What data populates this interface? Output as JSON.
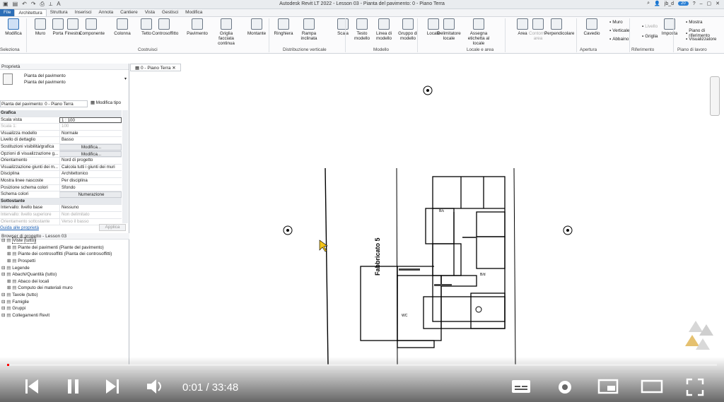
{
  "window": {
    "title": "Autodesk Revit LT 2022 - Lesson 03 - Pianta del pavimento: 0 - Piano Terra",
    "user": "jb_d",
    "badge": "20"
  },
  "tabs": [
    "File",
    "Architettura",
    "Struttura",
    "Inserisci",
    "Annota",
    "Cantiere",
    "Vista",
    "Gestisci",
    "Modifica"
  ],
  "ribbon": {
    "buttons": [
      "Modifica",
      "Muro",
      "Porta",
      "Finestra",
      "Componente",
      "Colonna",
      "Tetto",
      "Controsoffitto",
      "Pavimento",
      "Griglia facciata continua",
      "Montante",
      "Ringhiera",
      "Rampa inclinata",
      "Scala",
      "Testo modello",
      "Linea di modello",
      "Gruppo di modello",
      "Locale",
      "Delimitatore locale",
      "Assegna etichetta al locale",
      "Area",
      "Contorno area",
      "Perpendicolare",
      "Cavedio",
      "Imposta"
    ],
    "small": [
      "Muro",
      "Verticale",
      "Abbaino",
      "Livello",
      "Griglia",
      "Mostra",
      "Piano di riferimento",
      "Visualizzatore"
    ],
    "panels": [
      "Seleziona",
      "Costruisci",
      "Distribuzione verticale",
      "Modello",
      "Locale e area",
      "Apertura",
      "Riferimento",
      "Piano di lavoro"
    ]
  },
  "properties": {
    "header": "Proprietà",
    "type_name": "Pianta del pavimento",
    "type_sub": "Pianta del pavimento",
    "instance": "Pianta del pavimento: 0 - Piano Terra",
    "edit_type": "Modifica tipo",
    "rows": [
      {
        "k": "Grafica",
        "v": "",
        "cat": true
      },
      {
        "k": "Scala vista",
        "v": "1 : 100"
      },
      {
        "k": "Scala 1:",
        "v": "100",
        "dim": true
      },
      {
        "k": "Visualizza modello",
        "v": "Normale"
      },
      {
        "k": "Livello di dettaglio",
        "v": "Basso"
      },
      {
        "k": "Sostituzioni visibilità/grafica",
        "v": "Modifica...",
        "btn": true
      },
      {
        "k": "Opzioni di visualizzazione g...",
        "v": "Modifica...",
        "btn": true
      },
      {
        "k": "Orientamento",
        "v": "Nord di progetto"
      },
      {
        "k": "Visualizzazione giunti dei m...",
        "v": "Calcola tutti i giunti dei muri"
      },
      {
        "k": "Disciplina",
        "v": "Architettonico"
      },
      {
        "k": "Mostra linee nascoste",
        "v": "Per disciplina"
      },
      {
        "k": "Posizione schema colori",
        "v": "Sfondo"
      },
      {
        "k": "Schema colori",
        "v": "Numerazione",
        "btn": true
      },
      {
        "k": "Sottostante",
        "v": "",
        "cat": true
      },
      {
        "k": "Intervallo: livello base",
        "v": "Nessuno"
      },
      {
        "k": "Intervallo: livello superiore",
        "v": "Non delimitato",
        "dim": true
      },
      {
        "k": "Orientamento sottostante",
        "v": "Verso il basso",
        "dim": true
      }
    ],
    "help": "Guida alle proprietà",
    "apply": "Applica"
  },
  "browser": {
    "header": "Browser di progetto - Lesson 03",
    "items": [
      {
        "t": "Viste (tutto)",
        "lv": 0
      },
      {
        "t": "Piante dei pavimenti (Piante del pavimento)",
        "lv": 1
      },
      {
        "t": "Piante dei controsoffitti (Pianta dei controsoffitti)",
        "lv": 1
      },
      {
        "t": "Prospetti",
        "lv": 1
      },
      {
        "t": "Legende",
        "lv": 0
      },
      {
        "t": "Abachi/Quantità (tutto)",
        "lv": 0
      },
      {
        "t": "Abaco dei locali",
        "lv": 1
      },
      {
        "t": "Computo dei materiali muro",
        "lv": 1
      },
      {
        "t": "Tavole (tutto)",
        "lv": 0
      },
      {
        "t": "Famiglie",
        "lv": 0
      },
      {
        "t": "Gruppi",
        "lv": 0
      },
      {
        "t": "Collegamenti Revit",
        "lv": 0
      }
    ]
  },
  "view_tab": "0 - Piano Terra",
  "drawing": {
    "label": "Fabbricato 5",
    "rooms": [
      "B/c",
      "WC",
      "B/d"
    ]
  },
  "video": {
    "current": "0:01",
    "total": "33:48",
    "progress": 0.002
  }
}
